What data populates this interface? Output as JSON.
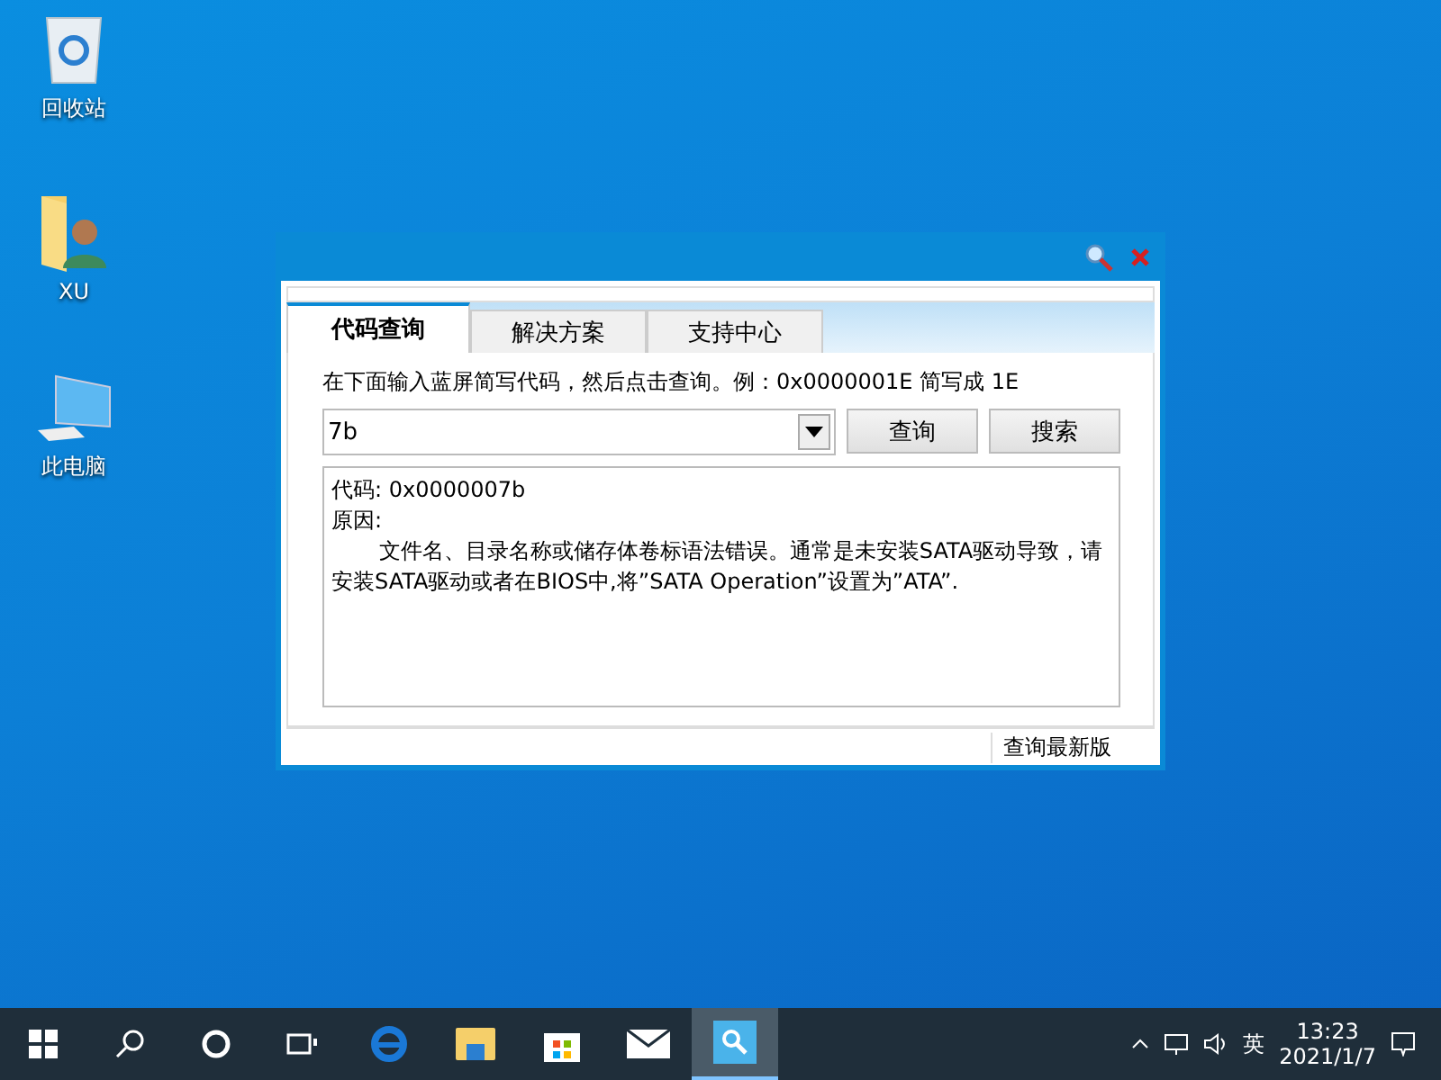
{
  "desktop_icons": [
    {
      "kind": "recycle",
      "label": "回收站"
    },
    {
      "kind": "user",
      "label": "XU"
    },
    {
      "kind": "computer",
      "label": "此电脑"
    }
  ],
  "window": {
    "tabs": [
      {
        "label": "代码查询",
        "selected": true
      },
      {
        "label": "解决方案",
        "selected": false
      },
      {
        "label": "支持中心",
        "selected": false
      }
    ],
    "instruction": "在下面输入蓝屏简写代码，然后点击查询。例：0x0000001E 简写成 1E",
    "code_field": {
      "value": "7b"
    },
    "buttons": [
      "查询",
      "搜索"
    ],
    "result": {
      "code_line": "代码: 0x0000007b",
      "reason_label": "原因:",
      "reason": "文件名、目录名称或储存体卷标语法错误。通常是未安装SATA驱动导致，请安装SATA驱动或者在BIOS中,将”SATA Operation”设置为”ATA”."
    },
    "status_bar": {
      "link": "查询最新版"
    }
  },
  "taskbar": {
    "apps": [
      {
        "kind": "start"
      },
      {
        "kind": "search"
      },
      {
        "kind": "cortana"
      },
      {
        "kind": "taskview"
      },
      {
        "kind": "edge"
      },
      {
        "kind": "explorer"
      },
      {
        "kind": "store"
      },
      {
        "kind": "mail"
      },
      {
        "kind": "tool",
        "selected": true
      }
    ],
    "ime": "英",
    "time": "13:23",
    "date": "2021/1/7"
  }
}
